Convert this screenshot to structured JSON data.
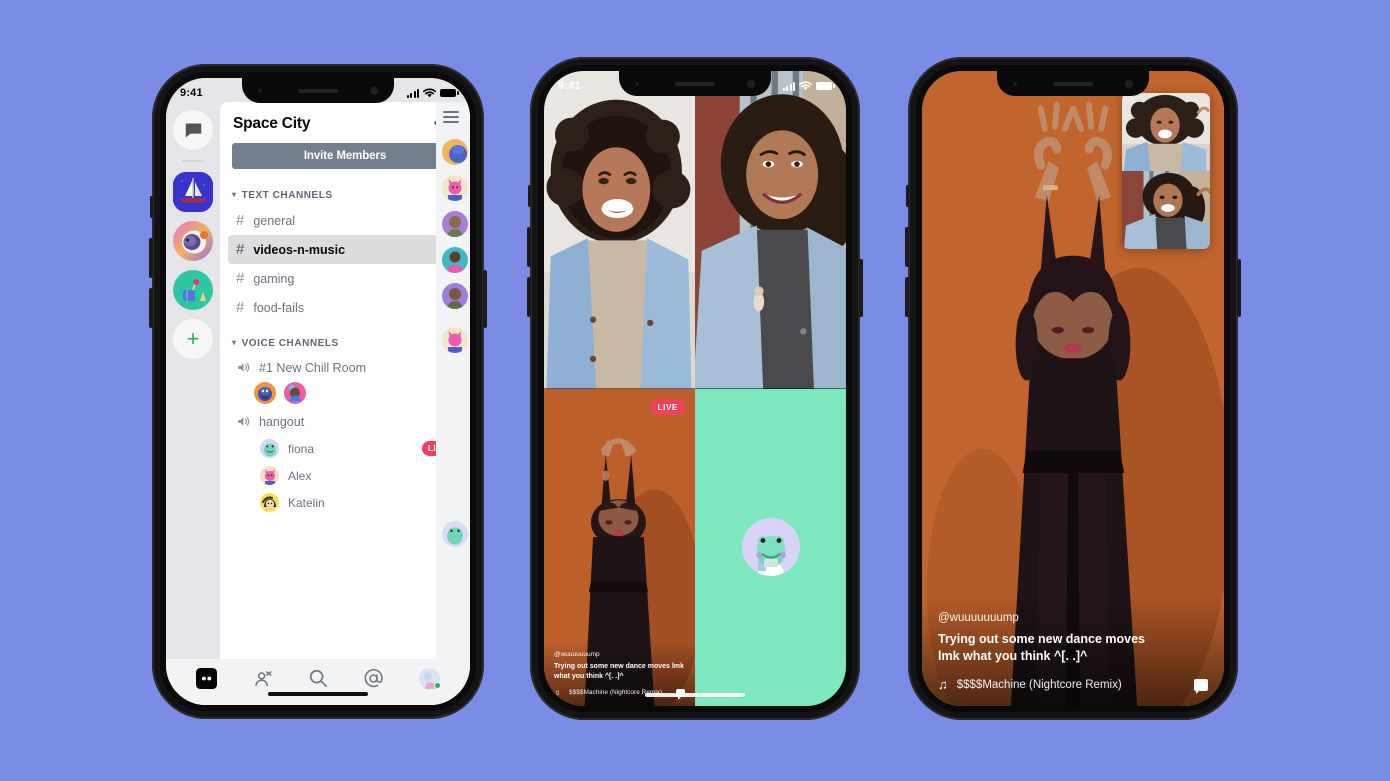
{
  "page": {
    "background_color": "#7B8CE6"
  },
  "phone1": {
    "status": {
      "time": "9:41",
      "signal_icon": "cellular-bars-icon",
      "wifi_icon": "wifi-icon",
      "battery_icon": "battery-icon"
    },
    "server_rail": {
      "items": [
        {
          "name": "home-dms",
          "icon": "chat-bubble-icon",
          "selected": false
        },
        {
          "name": "space-city",
          "icon": "sailboat-server-icon",
          "selected": true
        },
        {
          "name": "astronaut-server",
          "icon": "astronaut-server-icon",
          "selected": false
        },
        {
          "name": "teal-server",
          "icon": "picnic-server-icon",
          "selected": false
        }
      ],
      "add_label": "+"
    },
    "header": {
      "title": "Space City",
      "more_label": "•••",
      "more_icon": "more-horizontal-icon"
    },
    "invite_button": {
      "label": "Invite Members",
      "color": "#747F8D"
    },
    "categories": [
      {
        "label": "TEXT CHANNELS",
        "channels": [
          {
            "name": "general",
            "selected": false
          },
          {
            "name": "videos-n-music",
            "selected": true
          },
          {
            "name": "gaming",
            "selected": false
          },
          {
            "name": "food-fails",
            "selected": false
          }
        ]
      }
    ],
    "voice_category_label": "VOICE CHANNELS",
    "voice_channels": [
      {
        "name": "#1 New Chill Room",
        "connected_avatars": [
          "blue-bird-avatar",
          "pink-portrait-avatar"
        ],
        "members": []
      },
      {
        "name": "hangout",
        "connected_avatars": [],
        "members": [
          {
            "name": "fiona",
            "avatar": "frog-avatar",
            "badge": "LIVE",
            "video": false
          },
          {
            "name": "Alex",
            "avatar": "bunny-avatar",
            "badge": "",
            "video": true
          },
          {
            "name": "Katelin",
            "avatar": "yellow-avatar",
            "badge": "",
            "video": true
          }
        ]
      }
    ],
    "live_badge_color": "#F23F5B",
    "member_list": {
      "menu_icon": "hamburger-menu-icon",
      "avatars": [
        "blue-bird-avatar",
        "bunny-avatar",
        "purple-portrait-avatar",
        "teal-portrait-avatar",
        "purple-portrait-avatar",
        "bunny-avatar",
        "frog-avatar"
      ]
    },
    "tab_bar": [
      {
        "name": "servers",
        "icon": "discord-logo-icon",
        "active": true
      },
      {
        "name": "friends",
        "icon": "friends-icon",
        "active": false
      },
      {
        "name": "search",
        "icon": "search-icon",
        "active": false
      },
      {
        "name": "mentions",
        "icon": "at-mention-icon",
        "active": false
      },
      {
        "name": "profile",
        "icon": "user-avatar-icon",
        "active": false,
        "status": "online"
      }
    ]
  },
  "phone2": {
    "status": {
      "time": "9:41",
      "signal_icon": "cellular-bars-icon",
      "wifi_icon": "wifi-icon",
      "battery_icon": "battery-icon"
    },
    "tiles": [
      {
        "name": "participant-video-1",
        "type": "video",
        "description": "smiling person with curly hair in denim jacket"
      },
      {
        "name": "participant-video-2",
        "type": "video",
        "description": "smiling person with wavy hair in denim jacket"
      },
      {
        "name": "screen-share-stream",
        "type": "stream",
        "badge": "LIVE",
        "handle": "@wuuuuuuump",
        "caption": "Trying out some new dance moves lmk what you think ^[. .]^",
        "song": "$$$$Machine (Nightcore Remix)",
        "music_icon": "music-note-icon",
        "comment_icon": "comment-bubble-icon"
      },
      {
        "name": "participant-avatar-tile",
        "type": "avatar",
        "avatar": "frog-avatar",
        "background_color": "#7DE8C0"
      }
    ]
  },
  "phone3": {
    "stream": {
      "name": "fullscreen-stream",
      "handle": "@wuuuuuuump",
      "caption": "Trying out some new dance moves lmk what you think ^[. .]^",
      "song": "$$$$Machine (Nightcore Remix)",
      "music_icon": "music-note-icon",
      "comment_icon": "comment-bubble-icon"
    },
    "pip": {
      "name": "picture-in-picture-panel",
      "tiles": [
        {
          "name": "pip-video-1",
          "description": "smiling person with curly hair"
        },
        {
          "name": "pip-video-2",
          "description": "smiling person with wavy hair"
        }
      ]
    }
  }
}
